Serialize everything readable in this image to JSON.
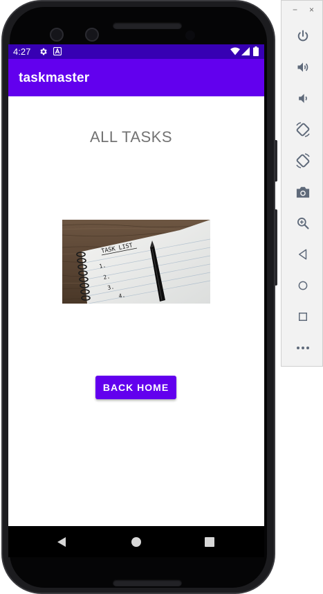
{
  "status_bar": {
    "time": "4:27",
    "icons": [
      "settings-icon",
      "a-badge-icon",
      "wifi-icon",
      "signal-icon",
      "battery-icon"
    ]
  },
  "app_bar": {
    "title": "taskmaster"
  },
  "main": {
    "heading": "ALL TASKS",
    "image": {
      "handwritten_text": "TASK LIST",
      "list_numbers": [
        "1.",
        "2.",
        "3.",
        "4."
      ]
    },
    "back_button_label": "BACK HOME"
  },
  "nav_bar": {
    "buttons": [
      "back-icon",
      "home-icon",
      "recents-icon"
    ]
  },
  "emulator_toolbar": {
    "window_controls": [
      "−",
      "×"
    ],
    "buttons": [
      "power-icon",
      "volume-up-icon",
      "volume-down-icon",
      "rotate-left-icon",
      "rotate-right-icon",
      "camera-icon",
      "zoom-icon",
      "back-icon",
      "home-icon",
      "overview-icon",
      "more-icon"
    ]
  },
  "colors": {
    "primary": "#6200ee",
    "primary_dark": "#3700b3",
    "heading_text": "#737373",
    "toolbar_icon": "#5f6a7a"
  }
}
